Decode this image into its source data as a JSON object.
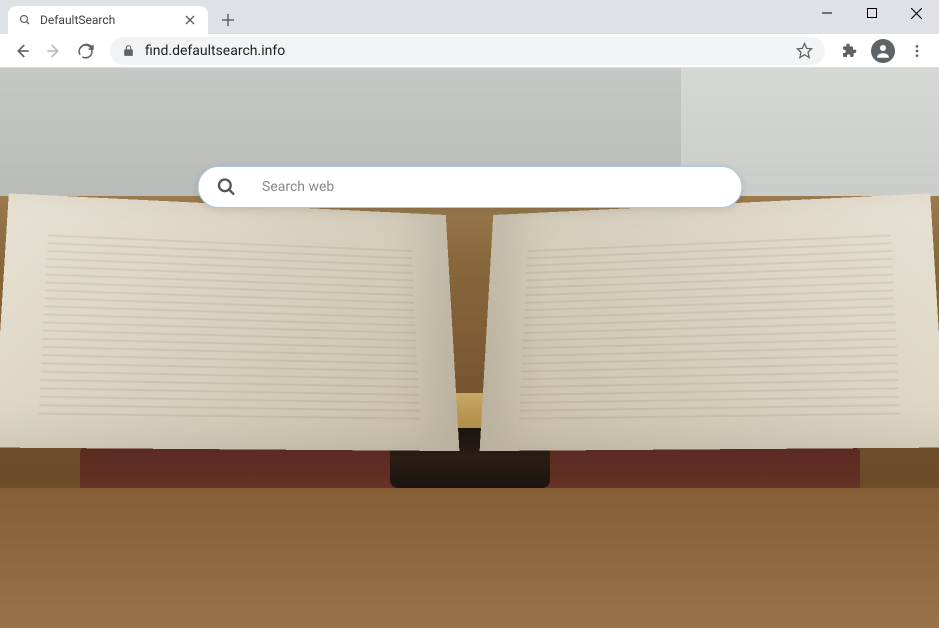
{
  "window": {
    "tab_title": "DefaultSearch"
  },
  "toolbar": {
    "url": "find.defaultsearch.info"
  },
  "page": {
    "search_placeholder": "Search web"
  }
}
